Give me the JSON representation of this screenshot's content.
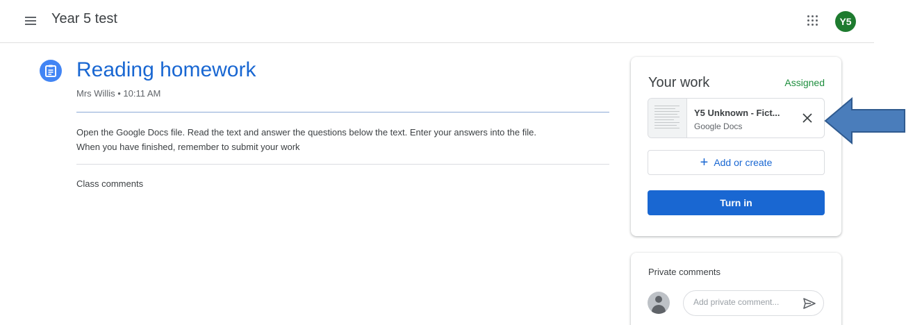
{
  "header": {
    "class_name": "Year 5 test",
    "avatar_initials": "Y5",
    "avatar_color": "#1e7b2f"
  },
  "assignment": {
    "title": "Reading homework",
    "meta": "Mrs Willis • 10:11 AM",
    "instructions": [
      "Open the Google Docs file.   Read the text and answer the questions below the text.  Enter your answers into the file.",
      "When you have finished, remember to submit your work"
    ],
    "class_comments_label": "Class comments",
    "accent_color": "#1967d2"
  },
  "your_work": {
    "title": "Your work",
    "status": "Assigned",
    "status_color": "#1e8e3e",
    "attachment": {
      "name": "Y5 Unknown - Fict...",
      "type": "Google Docs"
    },
    "add_label": "Add or create",
    "turn_in_label": "Turn in"
  },
  "private_comments": {
    "title": "Private comments",
    "placeholder": "Add private comment..."
  },
  "icons": [
    "menu-icon",
    "apps-icon",
    "assignment-icon",
    "close-icon",
    "plus-icon",
    "person-icon",
    "send-icon",
    "arrow-icon"
  ]
}
